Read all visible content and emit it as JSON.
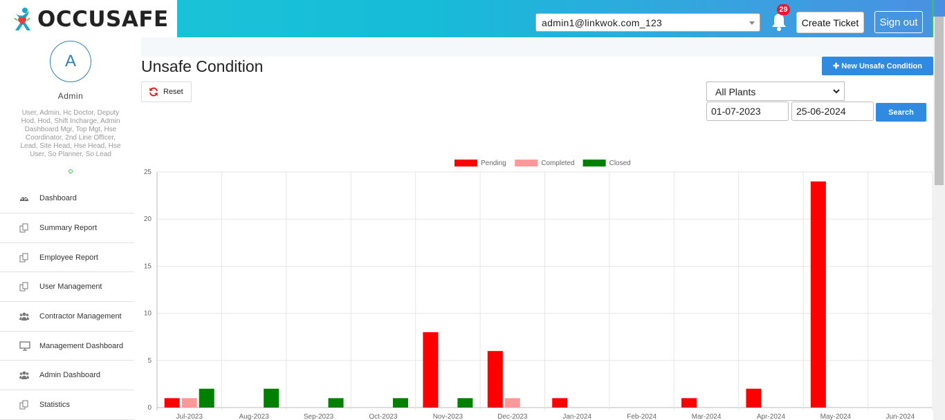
{
  "header": {
    "logo_text": "OCCUSAFE",
    "user_account": "admin1@linkwok.com_123",
    "notification_count": "29",
    "create_ticket_label": "Create Ticket",
    "sign_out_label": "Sign out"
  },
  "sidebar": {
    "avatar_letter": "A",
    "user_name": "Admin",
    "roles": "User, Admin, Hc Doctor, Deputy Hod, Hod, Shift Incharge, Admin Dashboard Mgr, Top Mgt, Hse Coordinator, 2nd Line Officer, Lead, Site Head, Hse Head, Hse User, So Planner, So Lead",
    "items": [
      {
        "label": "Dashboard",
        "icon": "dashboard-icon"
      },
      {
        "label": "Summary Report",
        "icon": "copy-icon"
      },
      {
        "label": "Employee Report",
        "icon": "copy-icon"
      },
      {
        "label": "User Management",
        "icon": "copy-icon"
      },
      {
        "label": "Contractor Management",
        "icon": "users-icon"
      },
      {
        "label": "Management Dashboard",
        "icon": "monitor-icon"
      },
      {
        "label": "Admin Dashboard",
        "icon": "users-icon"
      },
      {
        "label": "Statistics",
        "icon": "copy-icon"
      }
    ]
  },
  "main": {
    "title": "Unsafe Condition",
    "new_button_label": "New Unsafe Condition",
    "reset_label": "Reset",
    "plant_selected": "All Plants",
    "date_from": "01-07-2023",
    "date_to": "25-06-2024",
    "search_label": "Search"
  },
  "colors": {
    "pending": "#ff0000",
    "completed": "#ff9999",
    "closed": "#008000",
    "accent": "#2f8ae0"
  },
  "chart_data": {
    "type": "bar",
    "categories": [
      "Jul-2023",
      "Aug-2023",
      "Sep-2023",
      "Oct-2023",
      "Nov-2023",
      "Dec-2023",
      "Jan-2024",
      "Feb-2024",
      "Mar-2024",
      "Apr-2024",
      "May-2024",
      "Jun-2024"
    ],
    "series": [
      {
        "name": "Pending",
        "color": "#ff0000",
        "values": [
          1,
          0,
          0,
          0,
          8,
          6,
          1,
          0,
          1,
          2,
          24,
          0
        ]
      },
      {
        "name": "Completed",
        "color": "#ff9999",
        "values": [
          1,
          0,
          0,
          0,
          0,
          1,
          0,
          0,
          0,
          0,
          0,
          0
        ]
      },
      {
        "name": "Closed",
        "color": "#008000",
        "values": [
          2,
          2,
          1,
          1,
          1,
          0,
          0,
          0,
          0,
          0,
          0,
          0
        ]
      }
    ],
    "yticks": [
      0,
      5,
      10,
      15,
      20,
      25
    ],
    "ylim": [
      0,
      25
    ],
    "grid": true,
    "legend": "top-center"
  }
}
